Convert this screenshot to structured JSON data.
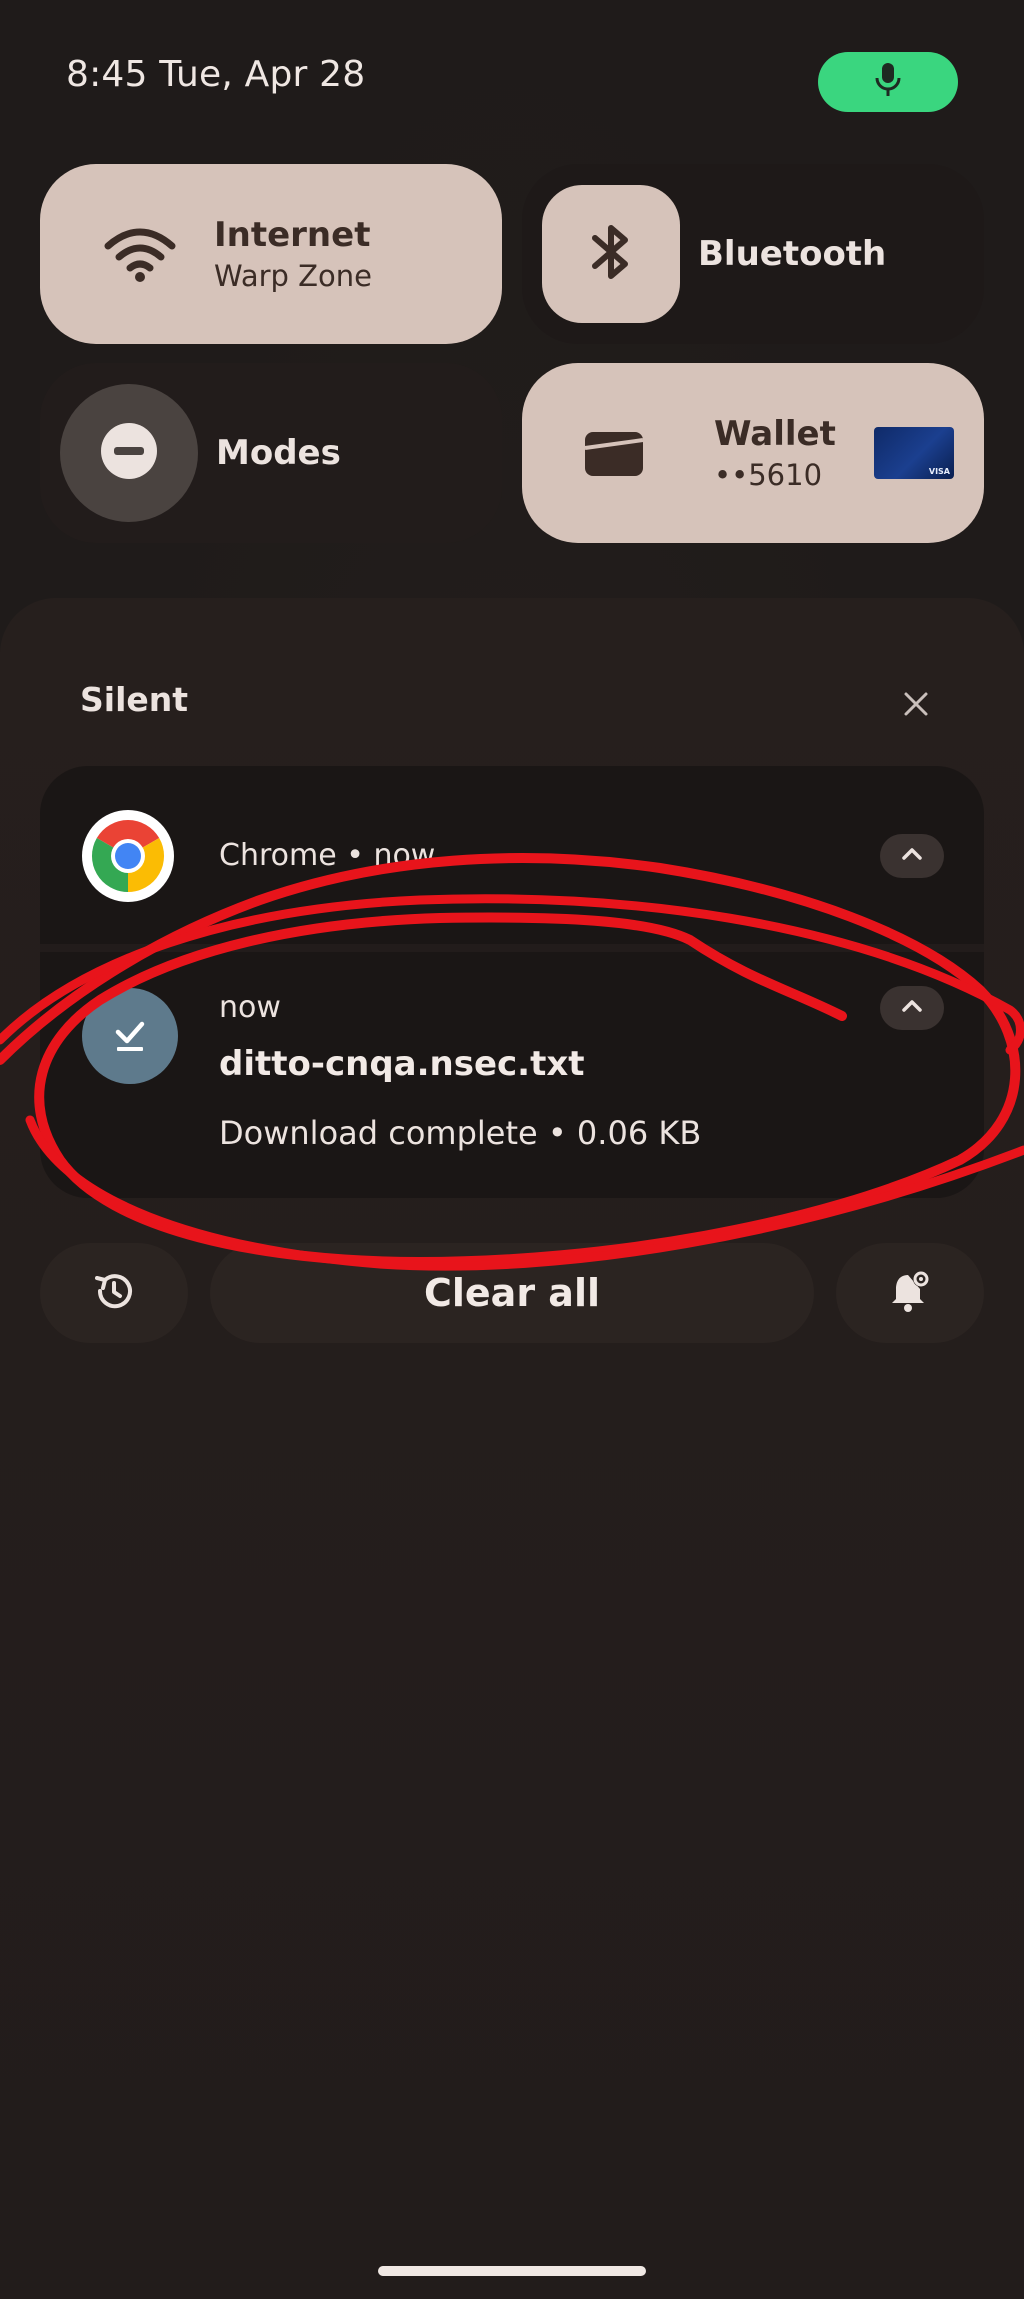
{
  "status_bar": {
    "time_date": "8:45   Tue, Apr 28",
    "mic_icon": "mic-icon",
    "mic_color": "#3ad67f"
  },
  "quick_settings": {
    "internet": {
      "title": "Internet",
      "subtitle": "Warp Zone",
      "icon": "wifi-icon"
    },
    "bluetooth": {
      "title": "Bluetooth",
      "icon": "bluetooth-icon"
    },
    "modes": {
      "title": "Modes",
      "icon": "do-not-disturb-icon"
    },
    "wallet": {
      "title": "Wallet",
      "subtitle": "••5610",
      "icon": "wallet-icon",
      "card_label": "VISA"
    },
    "active_tile_color": "#d6c3ba",
    "inactive_tile_color": "#2a2321"
  },
  "notifications": {
    "section_label": "Silent",
    "close_icon": "close-icon",
    "chrome": {
      "app_line": "Chrome • now",
      "icon": "chrome-icon"
    },
    "download": {
      "time": "now",
      "title": "ditto-cnqa.nsec.txt",
      "body": "Download complete • 0.06 KB",
      "icon": "download-done-icon"
    }
  },
  "actions": {
    "history_icon": "history-icon",
    "clear_all_label": "Clear all",
    "settings_icon": "notification-settings-icon"
  },
  "annotation": {
    "color": "#e8141b",
    "shape": "hand-drawn ellipse around download notification"
  }
}
